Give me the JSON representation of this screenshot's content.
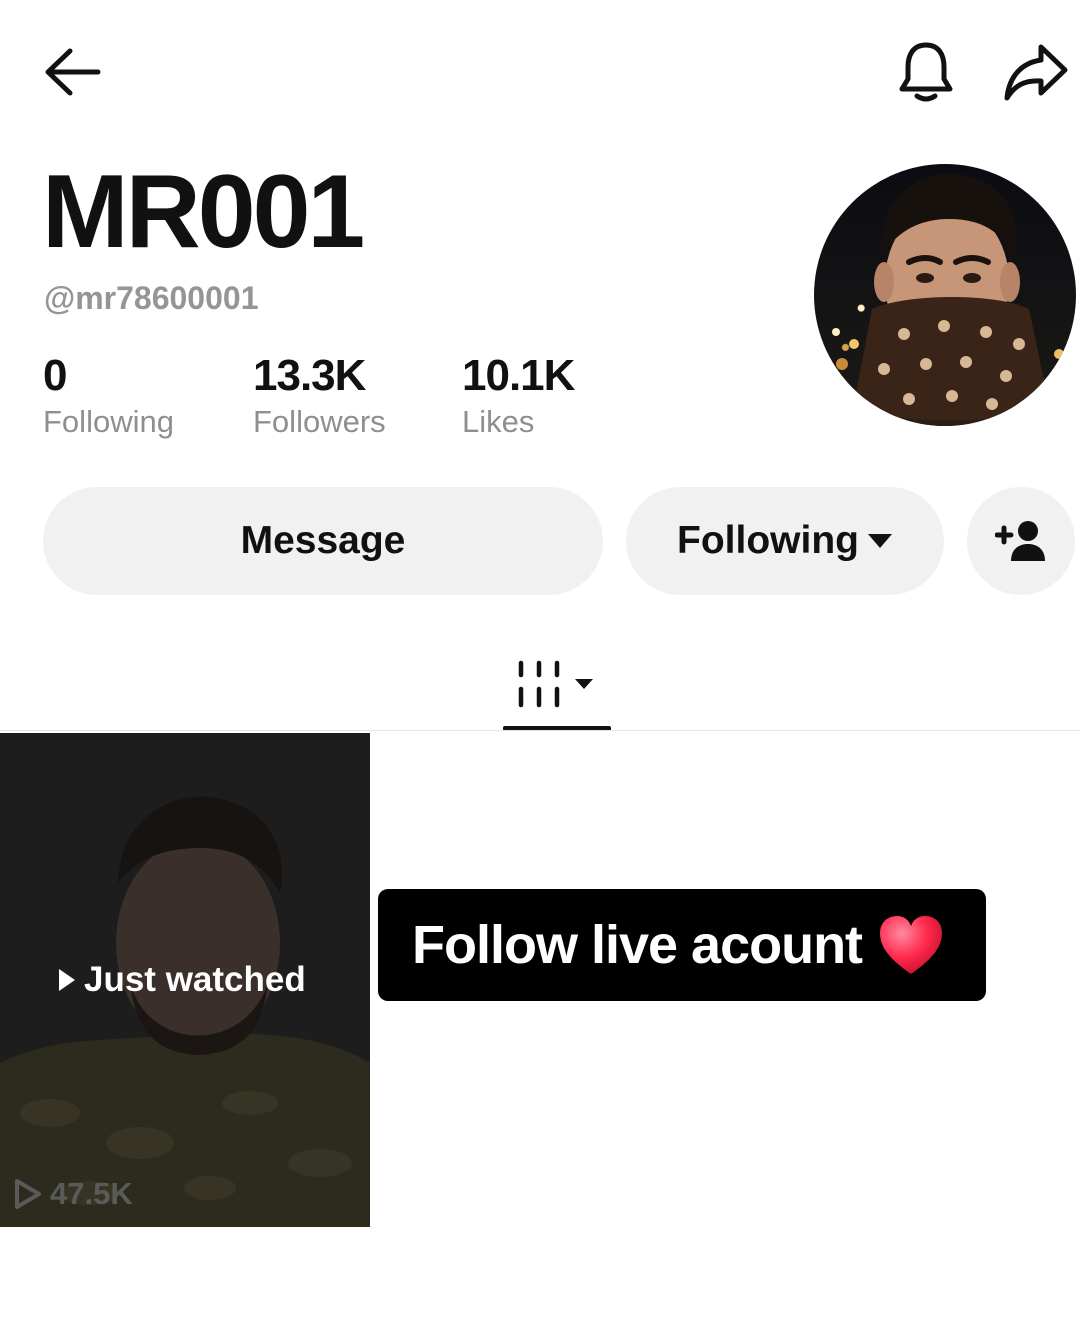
{
  "top_bar": {
    "back_icon": "arrow-left-icon",
    "notification_icon": "bell-icon",
    "share_icon": "share-arrow-icon"
  },
  "profile": {
    "display_name": "MR001",
    "handle": "@mr78600001",
    "avatar": "profile-photo"
  },
  "stats": [
    {
      "value": "0",
      "label": "Following"
    },
    {
      "value": "13.3K",
      "label": "Followers"
    },
    {
      "value": "10.1K",
      "label": "Likes"
    }
  ],
  "actions": {
    "message_label": "Message",
    "following_label": "Following",
    "add_friend_icon": "add-person-icon"
  },
  "tabs": {
    "videos_icon": "video-grid-icon"
  },
  "videos": [
    {
      "overlay_label": "Just watched",
      "views": "47.5K"
    }
  ],
  "banner": {
    "text": "Follow live acount",
    "emoji": "heart-icon"
  },
  "colors": {
    "pill_bg": "#f1f1f1",
    "muted_text": "#8f8f8f",
    "banner_bg": "#000000",
    "heart": "#ff2a4d"
  }
}
